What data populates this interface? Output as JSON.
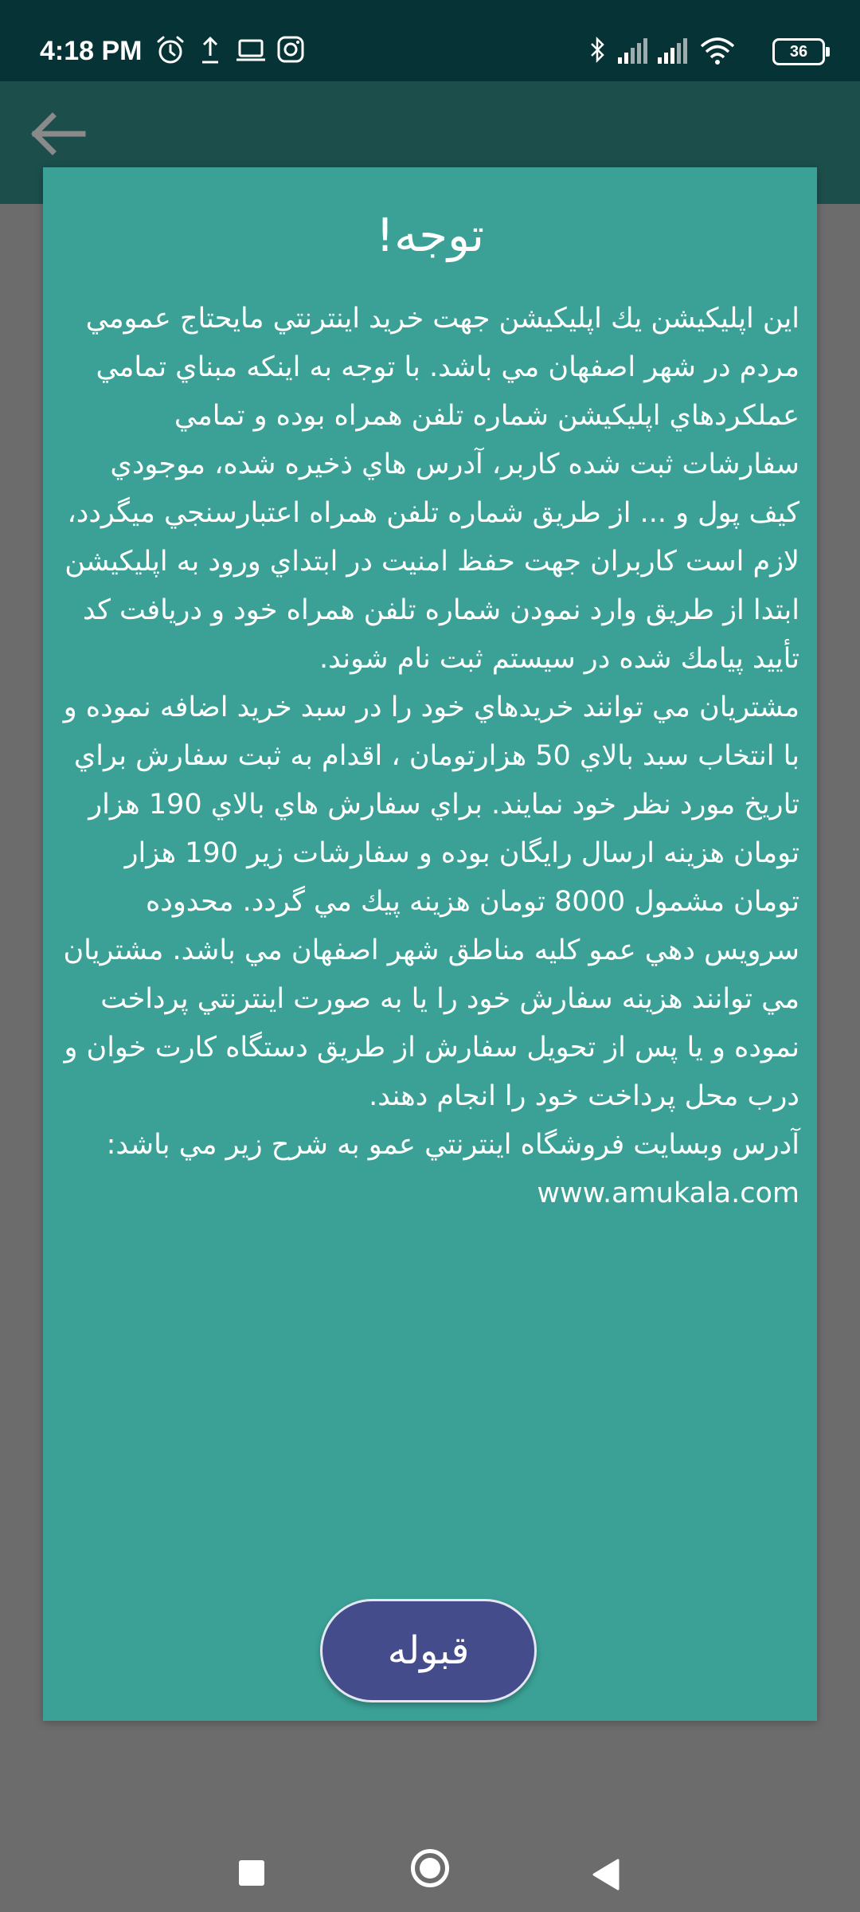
{
  "status_bar": {
    "time": "4:18 PM",
    "battery": "36",
    "left_icons": [
      "alarm-icon",
      "upload-icon",
      "laptop-icon",
      "instagram-icon"
    ],
    "right_icons": [
      "bluetooth-icon",
      "signal-icon",
      "signal-icon",
      "wifi-icon",
      "battery-icon"
    ]
  },
  "app_bar": {
    "back_icon": "arrow-left-icon"
  },
  "dialog": {
    "title": "توجه!",
    "message": "اين اپليكيشن يك اپليكيشن جهت خريد اينترنتي مايحتاج عمومي مردم در شهر اصفهان مي باشد. با توجه به اينكه مبناي تمامي عملكردهاي اپليكيشن شماره تلفن همراه بوده و تمامي سفارشات ثبت شده كاربر، آدرس هاي ذخيره شده، موجودي كيف پول و ... از طريق شماره تلفن همراه اعتبارسنجي ميگردد، لازم است كاربران جهت حفظ امنيت در ابتداي ورود به اپليكيشن ابتدا از طريق وارد نمودن شماره تلفن همراه خود و دريافت كد تأييد پيامك شده در سيستم ثبت نام شوند.\nمشتريان مي توانند خريدهاي خود را در سبد خريد اضافه نموده و با انتخاب سبد بالاي 50 هزارتومان ، اقدام به ثبت سفارش براي تاريخ مورد نظر خود نمايند. براي سفارش هاي بالاي 190 هزار تومان هزينه ارسال رايگان بوده و سفارشات زير 190 هزار تومان مشمول 8000 تومان هزينه پيك مي گردد. محدوده سرويس دهي عمو كليه مناطق شهر اصفهان مي باشد. مشتريان مي توانند هزينه سفارش خود را يا به صورت اينترنتي پرداخت نموده و يا پس از تحويل سفارش از طريق دستگاه كارت خوان و درب محل پرداخت خود را انجام دهند.\nآدرس وبسايت فروشگاه اينترنتي عمو به شرح زير مي باشد:\nwww.amukala.com",
    "accept_label": "قبوله"
  },
  "nav_bar": {
    "icons": [
      "recents-square-icon",
      "home-circle-icon",
      "back-triangle-icon"
    ]
  },
  "colors": {
    "status_bar": "#063336",
    "app_bar": "#1c4f4c",
    "scrim": "#6c6c6c",
    "dialog": "#3ba196",
    "button": "#454c8c",
    "button_border": "#e4e7f2",
    "text": "#ffffff"
  }
}
